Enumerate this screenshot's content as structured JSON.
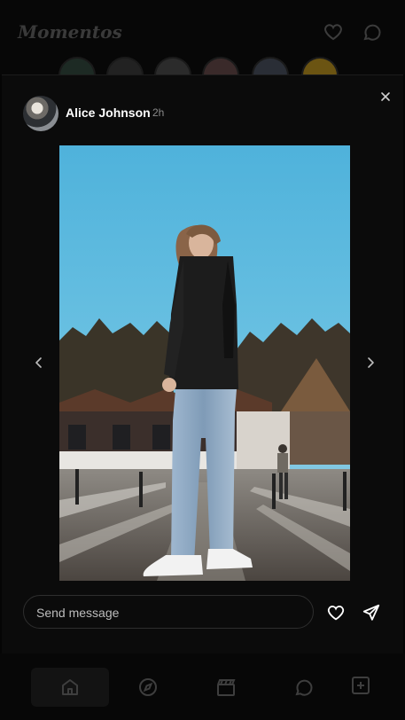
{
  "app": {
    "name": "Momentos"
  },
  "story": {
    "username": "Alice Johnson",
    "time_ago": "2h"
  },
  "composer": {
    "placeholder": "Send message"
  },
  "icons": {
    "top_like": "heart-icon",
    "top_messages": "chat-bubble-icon",
    "close": "close-icon",
    "prev": "chevron-left-icon",
    "next": "chevron-right-icon",
    "like": "heart-icon",
    "send": "send-icon",
    "nav_home": "home-icon",
    "nav_explore": "compass-icon",
    "nav_reels": "clapperboard-icon",
    "nav_messages": "chat-bubble-icon",
    "nav_create": "plus-square-icon"
  },
  "colors": {
    "background": "#050505",
    "modal": "#0b0b0b",
    "muted_text": "#8a8a8a",
    "sky": "#5ab7dc"
  }
}
